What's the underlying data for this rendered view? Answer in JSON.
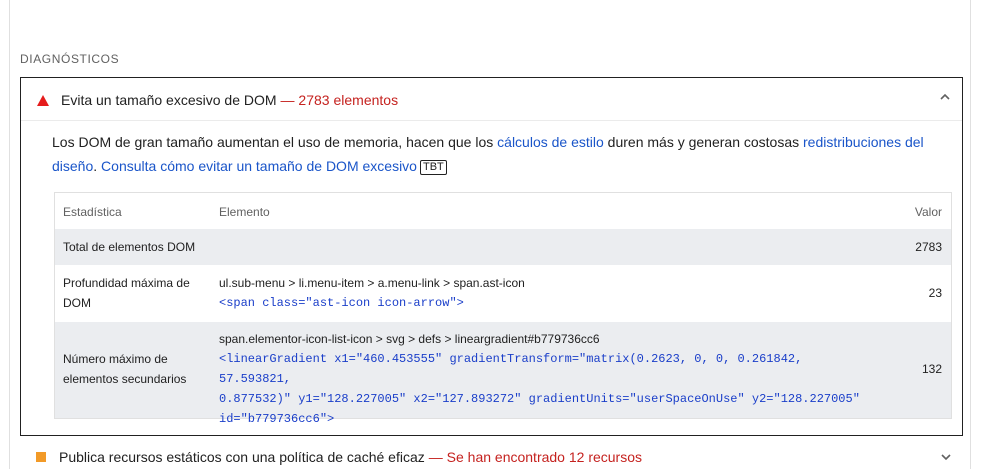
{
  "section": {
    "title": "DIAGNÓSTICOS"
  },
  "audit": {
    "title": "Evita un tamaño excesivo de DOM",
    "display_value": "— 2783 elementos",
    "description": {
      "text1": "Los DOM de gran tamaño aumentan el uso de memoria, hacen que los ",
      "link1": "cálculos de estilo",
      "text2": " duren más y generan costosas ",
      "link2": "redistribuciones del diseño",
      "text3": ". ",
      "link3": "Consulta cómo evitar un tamaño de DOM excesivo",
      "badge": "TBT"
    },
    "table": {
      "headers": {
        "stat": "Estadística",
        "element": "Elemento",
        "value": "Valor"
      },
      "rows": [
        {
          "label": "Total de elementos DOM",
          "selector": "",
          "snippet": "",
          "value": "2783"
        },
        {
          "label": "Profundidad máxima de DOM",
          "selector": "ul.sub-menu > li.menu-item > a.menu-link > span.ast-icon",
          "snippet": "<span class=\"ast-icon icon-arrow\">",
          "value": "23"
        },
        {
          "label": "Número máximo de elementos secundarios",
          "selector": "span.elementor-icon-list-icon > svg > defs > lineargradient#b779736cc6",
          "snippet_lines": [
            "<linearGradient x1=\"460.453555\" gradientTransform=\"matrix(0.2623, 0, 0, 0.261842, 57.593821,",
            "0.877532)\" y1=\"128.227005\" x2=\"127.893272\" gradientUnits=\"userSpaceOnUse\" y2=\"128.227005\"",
            "id=\"b779736cc6\">"
          ],
          "value": "132"
        }
      ]
    }
  },
  "audit2": {
    "title": "Publica recursos estáticos con una política de caché eficaz",
    "display_value": "— Se han encontrado 12 recursos"
  },
  "colors": {
    "fail": "#e51c1c",
    "average": "#f29a28",
    "link": "#1a55c9",
    "display_red": "#c5221f",
    "code": "#1a3ec9"
  },
  "icons": {
    "fail": "triangle-icon",
    "average": "square-icon",
    "collapse": "chevron-up-icon",
    "expand": "chevron-down-icon"
  }
}
